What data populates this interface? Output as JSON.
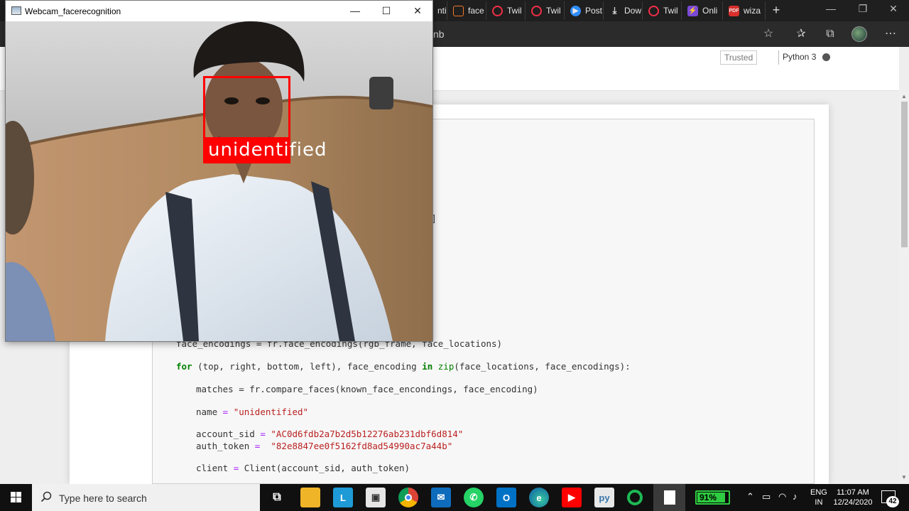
{
  "browser": {
    "tabs": [
      {
        "label": "nti",
        "icon": "jupyter-tab-icon",
        "color": "#f37726"
      },
      {
        "label": "face",
        "icon": "jupyter-tab-icon",
        "color": "#f37726"
      },
      {
        "label": "Twil",
        "icon": "twilio-tab-icon",
        "color": "#f22f46"
      },
      {
        "label": "Twil",
        "icon": "twilio-tab-icon",
        "color": "#f22f46"
      },
      {
        "label": "Post",
        "icon": "zoom-tab-icon",
        "color": "#2d8cff"
      },
      {
        "label": "Dow",
        "icon": "download-tab-icon",
        "color": "#dddddd"
      },
      {
        "label": "Twil",
        "icon": "twilio-tab-icon",
        "color": "#f22f46"
      },
      {
        "label": "Onli",
        "icon": "lightning-tab-icon",
        "color": "#7b4ad6"
      },
      {
        "label": "wiza",
        "icon": "pdf-tab-icon",
        "color": "#d9302c"
      }
    ],
    "address_fragment": "nb"
  },
  "jupyter": {
    "trusted": "Trusted",
    "kernel": "Python 3",
    "bracket": "]"
  },
  "code_lines": {
    "l1": "face_encodings = fr.face_encodings(rgb_frame, face_locations)",
    "l2_kw1": "for",
    "l2_a": " (top, right, bottom, left), face_encoding ",
    "l2_kw2": "in",
    "l2_b": " ",
    "l2_fn": "zip",
    "l2_c": "(face_locations, face_encodings):",
    "l3": "matches = fr.compare_faces(known_face_encondings, face_encoding)",
    "l4_a": "name ",
    "l4_op": "=",
    "l4_str": " \"unidentified\"",
    "l5_a": "account_sid ",
    "l5_op": "=",
    "l5_str": " \"AC0d6fdb2a7b2d5b12276ab231dbf6d814\"",
    "l6_a": "auth_token ",
    "l6_op": "=",
    "l6_str": "  \"82e8847ee0f5162fd8ad54990ac7a44b\"",
    "l7_a": "client ",
    "l7_op": "=",
    "l7_b": " Client(account_sid, auth_token)"
  },
  "webcam": {
    "title": "Webcam_facerecognition",
    "face_label": "unidentified",
    "box_color": "#ff0000"
  },
  "taskbar": {
    "search_placeholder": "Type here to search",
    "battery": "91%",
    "battery_level": 0.91,
    "lang_top": "ENG",
    "lang_bottom": "IN",
    "time": "11:07 AM",
    "date": "12/24/2020",
    "notification_count": "42",
    "apps": [
      {
        "name": "task-view-icon"
      },
      {
        "name": "file-explorer-icon"
      },
      {
        "name": "lync-app-icon"
      },
      {
        "name": "store-icon"
      },
      {
        "name": "chrome-icon"
      },
      {
        "name": "mail-icon"
      },
      {
        "name": "whatsapp-icon"
      },
      {
        "name": "outlook-icon"
      },
      {
        "name": "edge-icon"
      },
      {
        "name": "youtube-icon"
      },
      {
        "name": "python-file-icon"
      },
      {
        "name": "loading-app-icon"
      },
      {
        "name": "notepad-icon"
      }
    ]
  }
}
